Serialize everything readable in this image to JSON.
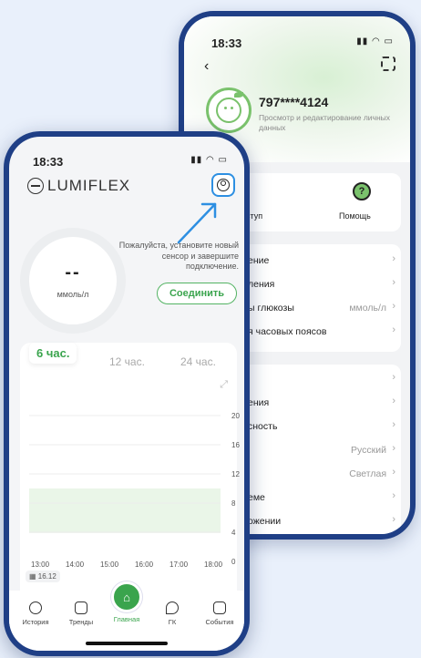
{
  "back_phone": {
    "time": "18:33",
    "user_phone": "797****4124",
    "user_subtitle": "Просмотр и редактирование личных данных",
    "quick": [
      {
        "label": "ступ",
        "icon": "lock-icon"
      },
      {
        "label": "Помощь",
        "icon": "help-icon"
      }
    ],
    "settings_group1": [
      {
        "label": "ение",
        "value": ""
      },
      {
        "label": "ления",
        "value": ""
      },
      {
        "label": "ы глюкозы",
        "value": "ммоль/л"
      },
      {
        "label": "я часовых поясов",
        "value": ""
      }
    ],
    "settings_group2": [
      {
        "label": "",
        "value": ""
      },
      {
        "label": "ения",
        "value": ""
      },
      {
        "label": "сность",
        "value": ""
      },
      {
        "label": "",
        "value": "Русский"
      },
      {
        "label": "",
        "value": "Светлая"
      },
      {
        "label": "еме",
        "value": ""
      },
      {
        "label": "ожении",
        "value": ""
      }
    ]
  },
  "front_phone": {
    "time": "18:33",
    "logo": "LUMIFLEX",
    "gauge_value": "--",
    "gauge_unit": "ммоль/л",
    "notice": "Пожалуйста, установите новый сенсор и завершите подключение.",
    "connect_label": "Соединить",
    "tabs": [
      "6 час.",
      "12 час.",
      "24 час."
    ],
    "chart": {
      "y_ticks": [
        "20",
        "16",
        "12",
        "8",
        "4",
        "0"
      ],
      "x_ticks": [
        "13:00",
        "14:00",
        "15:00",
        "16:00",
        "17:00",
        "18:00"
      ],
      "target_range": [
        3.9,
        10.0
      ],
      "date": "16.12"
    },
    "nav": [
      {
        "label": "История",
        "icon": "history-icon"
      },
      {
        "label": "Тренды",
        "icon": "trends-icon"
      },
      {
        "label": "Главная",
        "icon": "home-icon"
      },
      {
        "label": "ГК",
        "icon": "drop-icon"
      },
      {
        "label": "События",
        "icon": "events-icon"
      }
    ]
  },
  "colors": {
    "accent": "#3aa44d",
    "frame": "#1f3f86",
    "highlight": "#2d8fe2"
  }
}
